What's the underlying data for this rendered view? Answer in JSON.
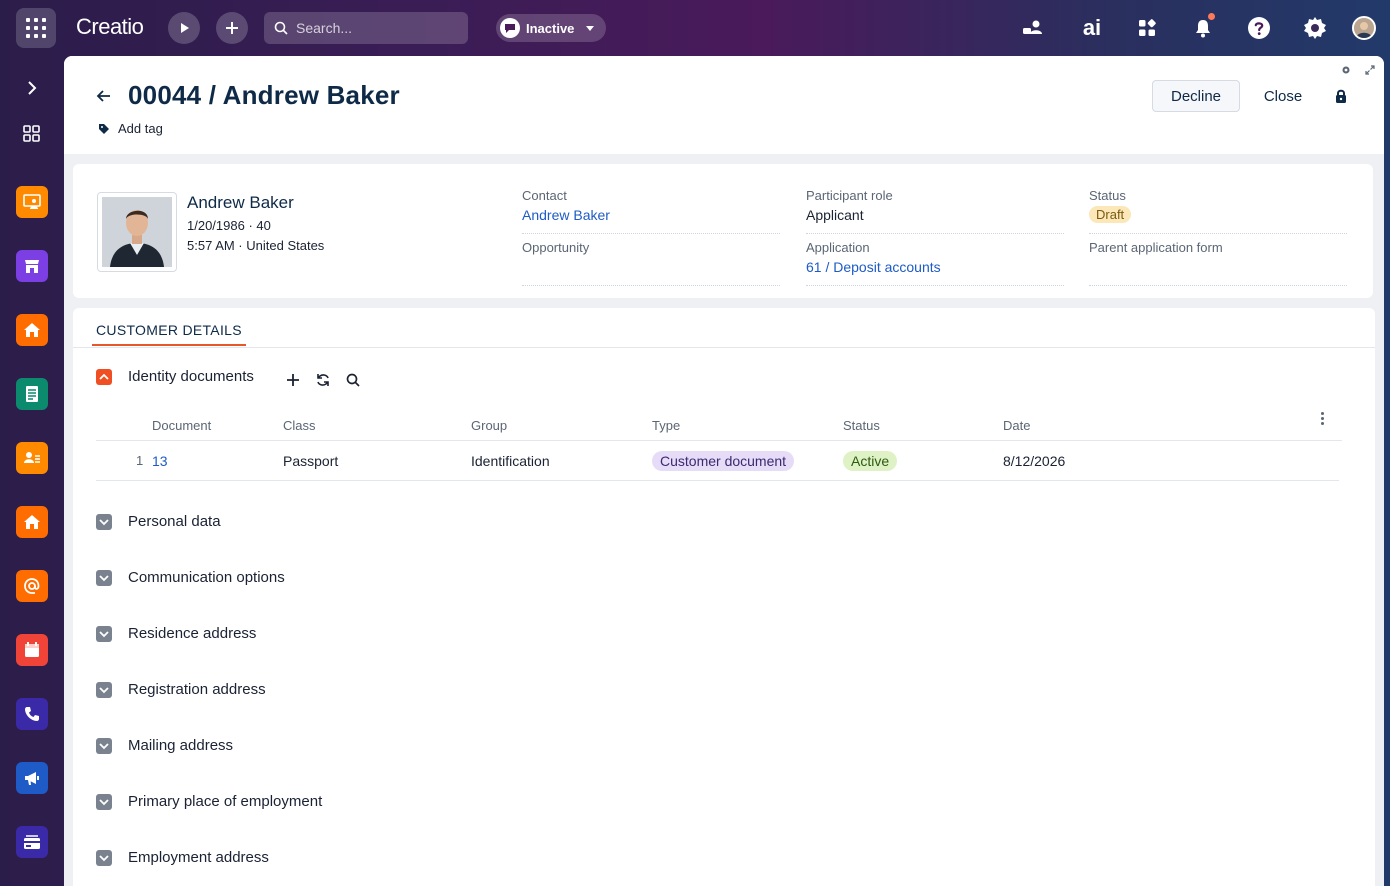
{
  "app": {
    "logo": "Creatio"
  },
  "topbar": {
    "search_placeholder": "Search...",
    "status": "Inactive",
    "ai_label": "ai"
  },
  "colors": {
    "accent": "#f04e23",
    "link": "#1e5bc6",
    "title": "#0e2a47"
  },
  "sidebar": {
    "items": [
      {
        "name": "sidebar-item-1",
        "icon": "presentation-user-icon",
        "color": "#ff8a00"
      },
      {
        "name": "sidebar-item-2",
        "icon": "store-icon",
        "color": "#7b3fe4"
      },
      {
        "name": "sidebar-item-3",
        "icon": "home-icon",
        "color": "#ff6d00"
      },
      {
        "name": "sidebar-item-4",
        "icon": "form-icon",
        "color": "#0b8a6e"
      },
      {
        "name": "sidebar-item-5",
        "icon": "contact-card-icon",
        "color": "#ff8a00"
      },
      {
        "name": "sidebar-item-6",
        "icon": "home-icon",
        "color": "#ff6d00"
      },
      {
        "name": "sidebar-item-7",
        "icon": "at-icon",
        "color": "#ff6d00"
      },
      {
        "name": "sidebar-item-8",
        "icon": "calendar-icon",
        "color": "#f04438"
      },
      {
        "name": "sidebar-item-9",
        "icon": "phone-icon",
        "color": "#3a2aa8"
      },
      {
        "name": "sidebar-item-10",
        "icon": "megaphone-icon",
        "color": "#1e5bc6"
      },
      {
        "name": "sidebar-item-11",
        "icon": "credit-card-icon",
        "color": "#3a2aa8"
      }
    ]
  },
  "header": {
    "title": "00044 / Andrew Baker",
    "add_tag": "Add tag",
    "decline": "Decline",
    "close": "Close"
  },
  "profile": {
    "name": "Andrew Baker",
    "birth": "1/20/1986 · 40",
    "local": "5:57 AM · United States",
    "fields": {
      "contact_label": "Contact",
      "contact_value": "Andrew Baker",
      "opportunity_label": "Opportunity",
      "opportunity_value": "",
      "role_label": "Participant role",
      "role_value": "Applicant",
      "application_label": "Application",
      "application_value": "61 / Deposit accounts",
      "status_label": "Status",
      "status_value": "Draft",
      "parent_label": "Parent application form",
      "parent_value": ""
    }
  },
  "details": {
    "tab": "CUSTOMER DETAILS",
    "identity_group": "Identity documents",
    "columns": [
      "Document",
      "Class",
      "Group",
      "Type",
      "Status",
      "Date"
    ],
    "rows": [
      {
        "index": "1",
        "document": "13",
        "class": "Passport",
        "group": "Identification",
        "type": "Customer document",
        "status": "Active",
        "date": "8/12/2026"
      }
    ],
    "groups": [
      "Personal data",
      "Communication options",
      "Residence address",
      "Registration address",
      "Mailing address",
      "Primary place of employment",
      "Employment address"
    ]
  }
}
